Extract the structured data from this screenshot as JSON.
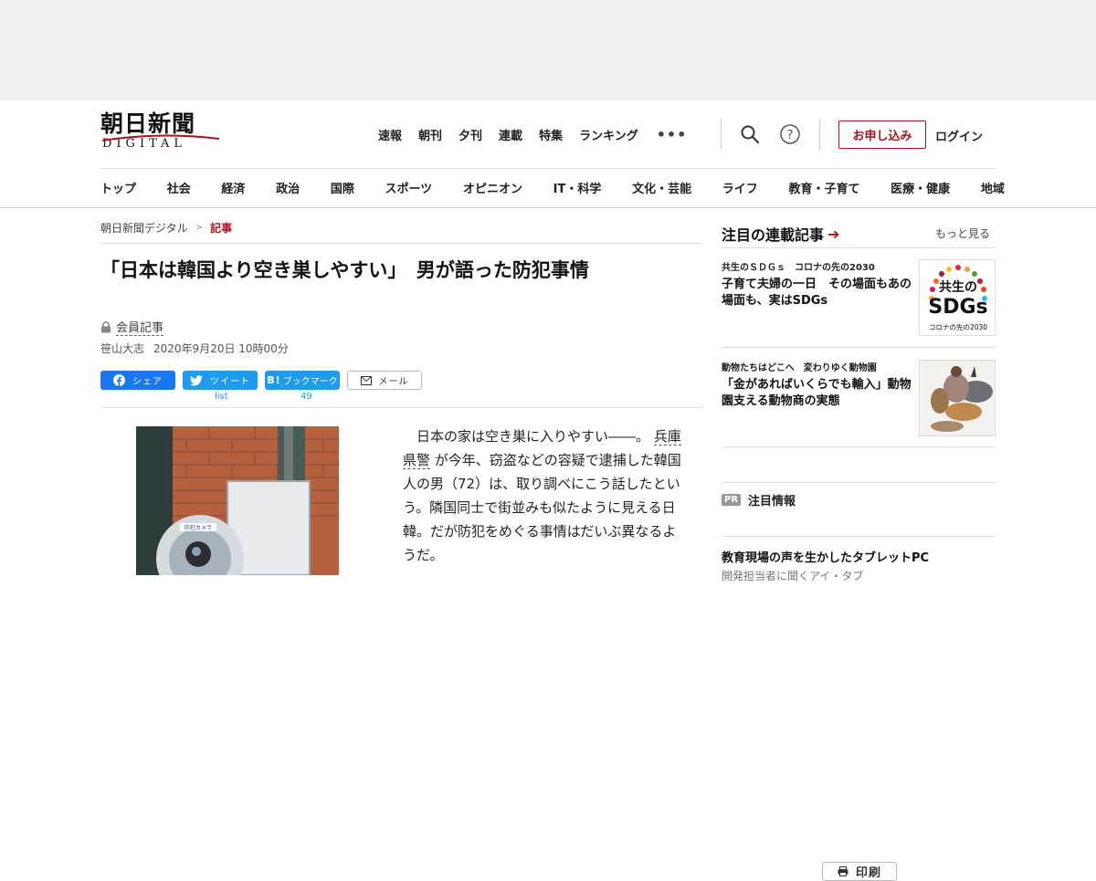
{
  "header": {
    "logo_jp": "朝日新聞",
    "logo_en": "DIGITAL",
    "top_nav": [
      "速報",
      "朝刊",
      "夕刊",
      "連載",
      "特集",
      "ランキング"
    ],
    "more_label": "•••",
    "search_icon": "search-icon",
    "help_icon": "help-icon",
    "apply_label": "お申し込み",
    "login_label": "ログイン",
    "categories": [
      "トップ",
      "社会",
      "経済",
      "政治",
      "国際",
      "スポーツ",
      "オピニオン",
      "IT・科学",
      "文化・芸能",
      "ライフ",
      "教育・子育て",
      "医療・健康",
      "地域"
    ],
    "accent_color": "#a8141d"
  },
  "breadcrumb": {
    "home": "朝日新聞デジタル",
    "sep": ">",
    "current": "記事"
  },
  "article": {
    "title": "「日本は韓国より空き巣しやすい」　男が語った防犯事情",
    "member_label": "会員記事",
    "author": "笹山大志",
    "date": "2020年9月20日 10時00分",
    "share": {
      "facebook": "シェア",
      "twitter": "ツイート",
      "twitter_count": "list",
      "hatena_icon": "B!",
      "hatena": "ブックマーク",
      "hatena_count": "49",
      "mail": "メール",
      "print": "印刷"
    },
    "body_pre": "日本の家は空き巣に入りやすい――。",
    "body_link": "兵庫県警",
    "body_post": "が今年、窃盗などの容疑で逮捕した韓国人の男（72）は、取り調べにこう話したという。隣国同士で街並みも似たように見える日韓。だが防犯をめぐる事情はだいぶ異なるようだ。",
    "photo_label": "防犯カメラ"
  },
  "sidebar": {
    "title": "注目の連載記事",
    "arrow": "➔",
    "more": "もっと見る",
    "cards": [
      {
        "series": "共生のＳＤＧｓ　コロナの先の2030",
        "headline": "子育て夫婦の一日　その場面もあの場面も、実はSDGs",
        "thumb_line1": "共生の",
        "thumb_line2": "SDGs",
        "thumb_line3": "コロナの先の2030"
      },
      {
        "series": "動物たちはどこへ　変わりゆく動物園",
        "headline": "「金があればいくらでも輸入」動物園支える動物商の実態"
      }
    ],
    "pr_tag": "PR",
    "pr_label": "注目情報",
    "pr_headline": "教育現場の声を生かしたタブレットPC",
    "pr_sub": "開発担当者に聞くアイ・タブ"
  }
}
